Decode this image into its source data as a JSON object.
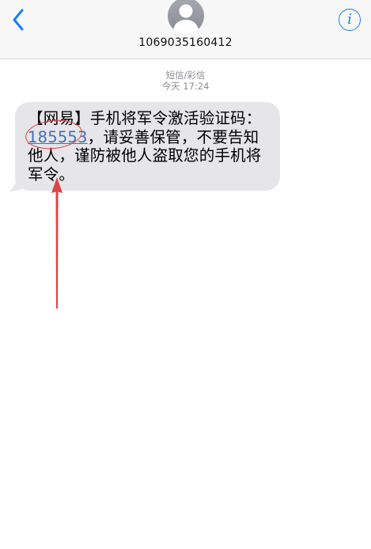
{
  "header": {
    "contact_name": "1069035160412",
    "back_icon": "chevron-left-icon",
    "info_icon": "info-icon",
    "info_glyph": "i",
    "accent_color": "#157efb"
  },
  "conversation": {
    "type_label": "短信/彩信",
    "timestamp": "今天 17:24"
  },
  "message": {
    "prefix": "【网易】手机将军令激活验证码：",
    "code": "185553",
    "suffix": "，请妥善保管，不要告知他人，谨防被他人盗取您的手机将军令。",
    "bubble_color": "#e5e5ea"
  },
  "annotation": {
    "color": "#e04343"
  }
}
